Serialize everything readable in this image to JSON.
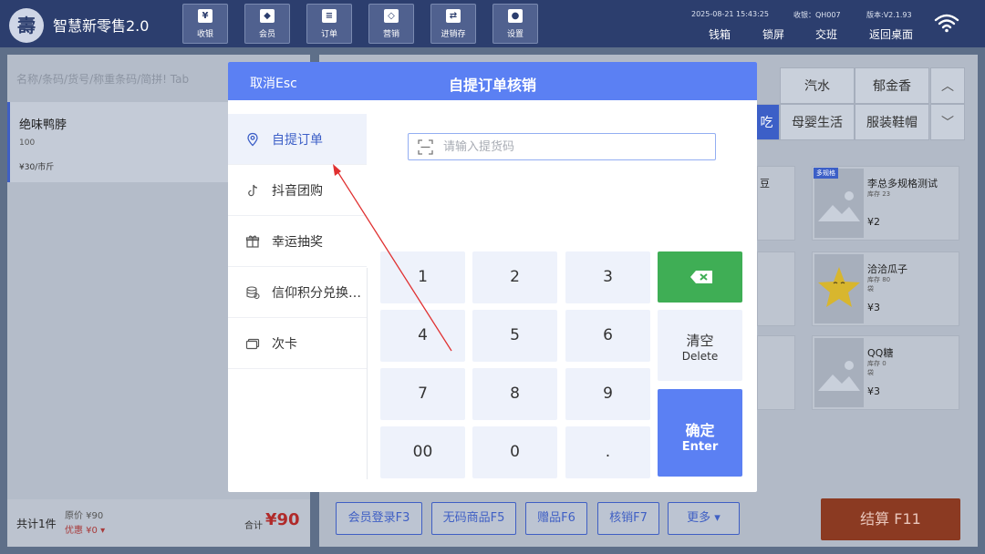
{
  "app": {
    "name": "智慧新零售2.0",
    "logo_glyph": "壽"
  },
  "nav": [
    {
      "label": "收银",
      "icon": "cashier-icon",
      "glyph": "¥"
    },
    {
      "label": "会员",
      "icon": "diamond-icon",
      "glyph": "◆"
    },
    {
      "label": "订单",
      "icon": "order-icon",
      "glyph": "≡"
    },
    {
      "label": "营销",
      "icon": "tag-icon",
      "glyph": "◇"
    },
    {
      "label": "进销存",
      "icon": "exchange-icon",
      "glyph": "⇄"
    },
    {
      "label": "设置",
      "icon": "settings-icon",
      "glyph": "●"
    }
  ],
  "meta": {
    "datetime": "2025-08-21 15:43:25",
    "cashier": "收银：QH007",
    "version": "版本:V2.1.93"
  },
  "top_actions": [
    "钱箱",
    "锁屏",
    "交班",
    "返回桌面"
  ],
  "left": {
    "search_placeholder": "名称/条码/货号/称重条码/简拼! Tab",
    "item": {
      "name": "绝味鸭脖",
      "qty": "100",
      "price": "¥30/市斤"
    },
    "footer": {
      "count": "共计1件",
      "orig": "原价 ¥90",
      "discount": "优惠 ¥0 ▾",
      "total_label": "合计",
      "total_value": "¥90"
    }
  },
  "categories": [
    {
      "label": "汽水"
    },
    {
      "label": "郁金香"
    },
    {
      "label": "吃"
    },
    {
      "label": "母婴生活"
    },
    {
      "label": "服装鞋帽"
    }
  ],
  "products": [
    {
      "name": "李总多规格测试",
      "stock": "库存 23",
      "unit": "",
      "price": "¥2",
      "tag": "多规格"
    },
    {
      "name": "洽洽瓜子",
      "stock": "库存 80",
      "unit": "袋",
      "price": "¥3",
      "tag": ""
    },
    {
      "name": "QQ糖",
      "stock": "库存 0",
      "unit": "袋",
      "price": "¥3",
      "tag": ""
    }
  ],
  "partial_product": {
    "name": "豆"
  },
  "footer_buttons": [
    "会员登录F3",
    "无码商品F5",
    "赠品F6",
    "核销F7",
    "更多 ▾"
  ],
  "checkout": "结算 F11",
  "modal": {
    "cancel": "取消Esc",
    "title": "自提订单核销",
    "tabs": [
      {
        "label": "自提订单",
        "icon": "location-pin-icon"
      },
      {
        "label": "抖音团购",
        "icon": "tiktok-icon"
      },
      {
        "label": "幸运抽奖",
        "icon": "gift-icon"
      },
      {
        "label": "信仰积分兑换…",
        "icon": "coins-icon"
      },
      {
        "label": "次卡",
        "icon": "card-icon"
      }
    ],
    "code_placeholder": "请输入提货码",
    "keys": [
      "1",
      "2",
      "3",
      "4",
      "5",
      "6",
      "7",
      "8",
      "9",
      "00",
      "0",
      "."
    ],
    "clear": {
      "cn": "清空",
      "en": "Delete"
    },
    "confirm": {
      "cn": "确定",
      "en": "Enter"
    }
  },
  "colors": {
    "accent": "#5b80f3",
    "topbar": "#2c3e6e",
    "backspace": "#3fae55",
    "checkout": "#8b3a22",
    "annotation_arrow": "#e03030"
  }
}
